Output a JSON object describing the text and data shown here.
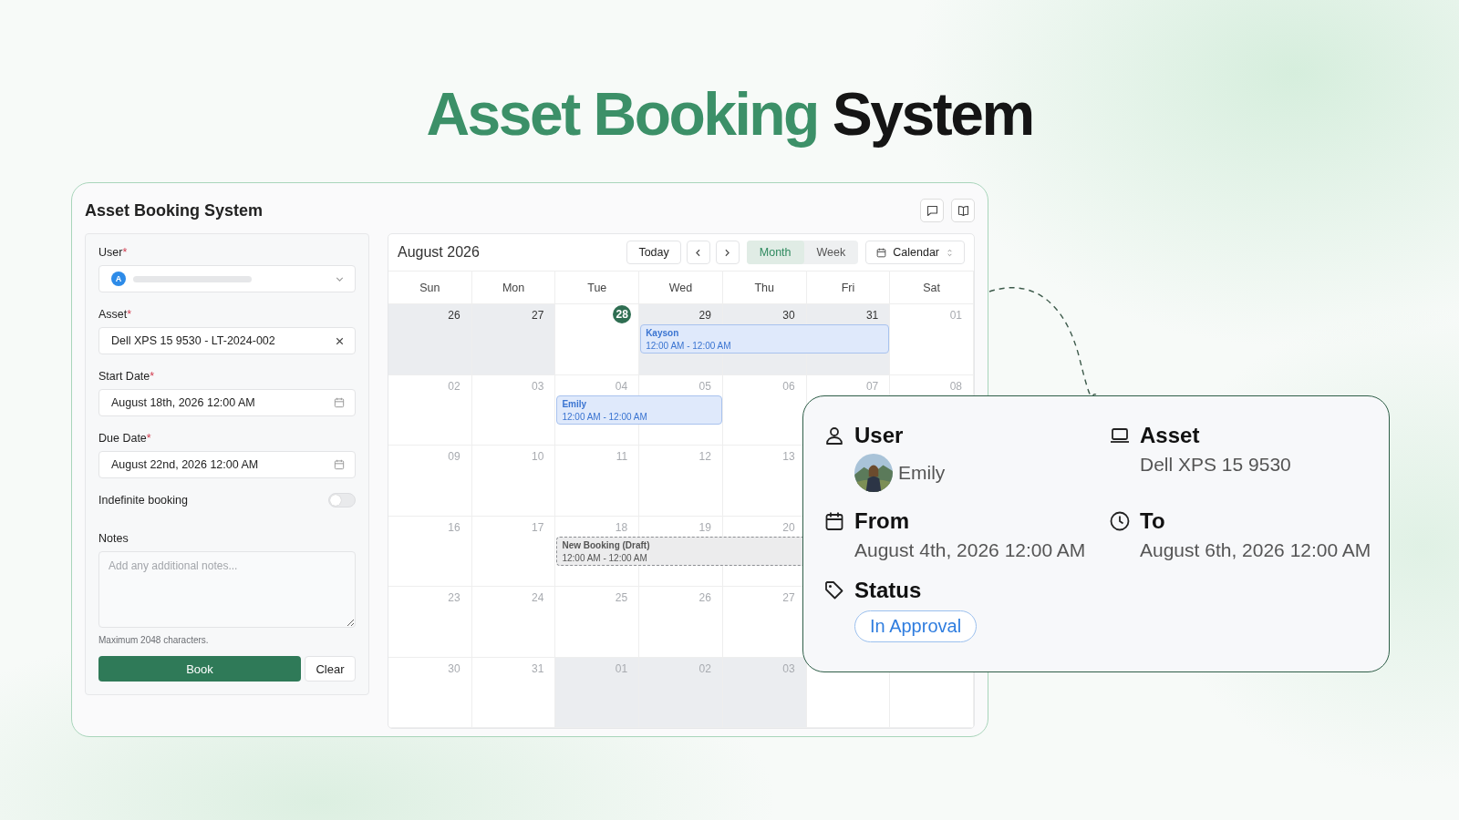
{
  "heading": {
    "accent": "Asset Booking",
    "rest": "System"
  },
  "app": {
    "title": "Asset Booking System"
  },
  "form": {
    "fields": [
      {
        "kind": "user-select",
        "label": "User",
        "required_mark": "*",
        "avatar_letter": "A"
      },
      {
        "kind": "select",
        "label": "Asset",
        "required_mark": "*",
        "value": "Dell XPS 15 9530 - LT-2024-002"
      },
      {
        "kind": "date",
        "label": "Start Date",
        "required_mark": "*",
        "value": "August 18th, 2026 12:00 AM"
      },
      {
        "kind": "date",
        "label": "Due Date",
        "required_mark": "*",
        "value": "August 22nd, 2026 12:00 AM"
      },
      {
        "kind": "toggle",
        "label": "Indefinite booking",
        "on": false
      },
      {
        "kind": "textarea",
        "label": "Notes",
        "placeholder": "Add any additional notes...",
        "hint": "Maximum 2048 characters."
      }
    ],
    "buttons": [
      {
        "label": "Book",
        "kind": "primary"
      },
      {
        "label": "Clear",
        "kind": "secondary"
      }
    ]
  },
  "calendar": {
    "title": "August 2026",
    "today_button": "Today",
    "views": [
      {
        "label": "Month",
        "selected": true
      },
      {
        "label": "Week",
        "selected": false
      }
    ],
    "calendar_select": "Calendar",
    "weekdays": [
      "Sun",
      "Mon",
      "Tue",
      "Wed",
      "Thu",
      "Fri",
      "Sat"
    ],
    "weeks": [
      {
        "days": [
          {
            "label": "26",
            "shaded": true,
            "dark": true,
            "today": false
          },
          {
            "label": "27",
            "shaded": true,
            "dark": true,
            "today": false
          },
          {
            "label": "28",
            "shaded": false,
            "dark": false,
            "today": true
          },
          {
            "label": "29",
            "shaded": true,
            "dark": true,
            "today": false,
            "event": {
              "kind": "booking",
              "name": "Kayson",
              "time": "12:00 AM - 12:00 AM"
            }
          },
          {
            "label": "30",
            "shaded": true,
            "dark": true,
            "today": false,
            "covered": true
          },
          {
            "label": "31",
            "shaded": true,
            "dark": true,
            "today": false,
            "covered": true
          },
          {
            "label": "01",
            "shaded": false,
            "dark": false,
            "today": false
          }
        ]
      },
      {
        "days": [
          {
            "label": "02",
            "shaded": false,
            "dark": false,
            "today": false
          },
          {
            "label": "03",
            "shaded": false,
            "dark": false,
            "today": false
          },
          {
            "label": "04",
            "shaded": false,
            "dark": false,
            "today": false,
            "event": {
              "kind": "booking",
              "name": "Emily",
              "time": "12:00 AM - 12:00 AM"
            }
          },
          {
            "label": "05",
            "shaded": false,
            "dark": false,
            "today": false,
            "covered": true
          },
          {
            "label": "06",
            "shaded": false,
            "dark": false,
            "today": false
          },
          {
            "label": "07",
            "shaded": false,
            "dark": false,
            "today": false
          },
          {
            "label": "08",
            "shaded": false,
            "dark": false,
            "today": false
          }
        ]
      },
      {
        "days": [
          {
            "label": "09",
            "shaded": false,
            "dark": false,
            "today": false
          },
          {
            "label": "10",
            "shaded": false,
            "dark": false,
            "today": false
          },
          {
            "label": "11",
            "shaded": false,
            "dark": false,
            "today": false
          },
          {
            "label": "12",
            "shaded": false,
            "dark": false,
            "today": false
          },
          {
            "label": "13",
            "shaded": false,
            "dark": false,
            "today": false
          }
        ]
      },
      {
        "days": [
          {
            "label": "16",
            "shaded": false,
            "dark": false,
            "today": false
          },
          {
            "label": "17",
            "shaded": false,
            "dark": false,
            "today": false
          },
          {
            "label": "18",
            "shaded": false,
            "dark": false,
            "today": false,
            "event": {
              "kind": "draft",
              "name": "New Booking (Draft)",
              "time": "12:00 AM - 12:00 AM"
            }
          },
          {
            "label": "19",
            "shaded": false,
            "dark": false,
            "today": false,
            "covered": true
          },
          {
            "label": "20",
            "shaded": false,
            "dark": false,
            "today": false,
            "covered": true
          }
        ]
      },
      {
        "days": [
          {
            "label": "23",
            "shaded": false,
            "dark": false,
            "today": false
          },
          {
            "label": "24",
            "shaded": false,
            "dark": false,
            "today": false
          },
          {
            "label": "25",
            "shaded": false,
            "dark": false,
            "today": false
          },
          {
            "label": "26",
            "shaded": false,
            "dark": false,
            "today": false
          },
          {
            "label": "27",
            "shaded": false,
            "dark": false,
            "today": false
          }
        ]
      },
      {
        "days": [
          {
            "label": "30",
            "shaded": false,
            "dark": false,
            "today": false
          },
          {
            "label": "31",
            "shaded": false,
            "dark": false,
            "today": false
          },
          {
            "label": "01",
            "shaded": true,
            "dark": false,
            "today": false
          },
          {
            "label": "02",
            "shaded": true,
            "dark": false,
            "today": false
          },
          {
            "label": "03",
            "shaded": true,
            "dark": false,
            "today": false
          }
        ]
      }
    ]
  },
  "popup": {
    "sections": [
      {
        "label": "User",
        "kind": "avatar",
        "value": "Emily"
      },
      {
        "label": "Asset",
        "kind": "text",
        "value": "Dell XPS 15 9530"
      },
      {
        "label": "From",
        "kind": "text",
        "value": "August 4th, 2026 12:00 AM"
      },
      {
        "label": "To",
        "kind": "text",
        "value": "August 6th, 2026 12:00 AM"
      },
      {
        "label": "Status",
        "kind": "badge",
        "value": "In Approval"
      }
    ]
  }
}
